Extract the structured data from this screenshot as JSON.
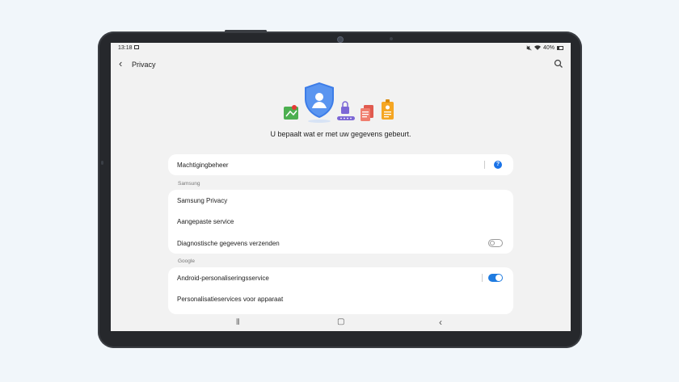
{
  "status_bar": {
    "time": "13:18",
    "battery": "40%"
  },
  "appbar": {
    "title": "Privacy",
    "back_glyph": "‹"
  },
  "hero": {
    "caption": "U bepaalt wat er met uw gegevens gebeurt."
  },
  "permissions": {
    "label": "Machtigingbeheer",
    "help_glyph": "?"
  },
  "samsung_section": {
    "header": "Samsung",
    "items": [
      {
        "label": "Samsung Privacy"
      },
      {
        "label": "Aangepaste service"
      },
      {
        "label": "Diagnostische gegevens verzenden",
        "toggle": false
      }
    ]
  },
  "google_section": {
    "header": "Google",
    "items": [
      {
        "label": "Android-personaliseringsservice",
        "toggle": true
      },
      {
        "label": "Personalisatieservices voor apparaat"
      }
    ]
  },
  "navbar": {
    "recents_glyph": "⦀",
    "home_glyph": "▢",
    "back_glyph": "‹"
  },
  "colors": {
    "accent": "#1f7be0",
    "screen_bg": "#f2f2f2",
    "page_bg": "#f1f6fa"
  },
  "icons": [
    "image-icon",
    "mute-icon",
    "wifi-icon",
    "battery-icon",
    "search-icon",
    "shield-user-icon",
    "map-icon",
    "lock-icon",
    "files-icon",
    "id-badge-icon",
    "help-icon"
  ]
}
